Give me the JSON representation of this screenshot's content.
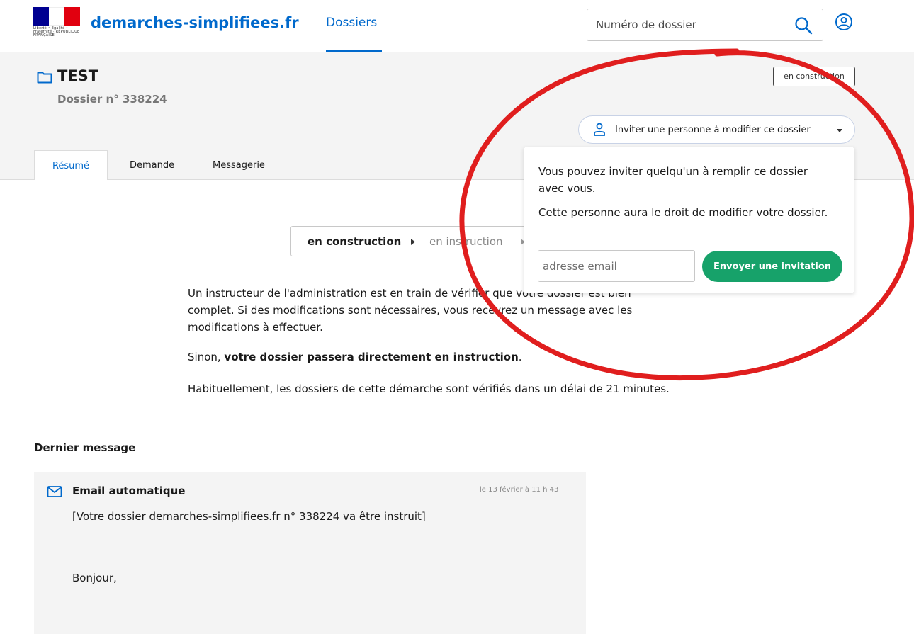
{
  "header": {
    "logo_caption": "Liberté • Égalité • Fraternité · RÉPUBLIQUE FRANÇAISE",
    "site_name": "demarches-simplifiees.fr",
    "nav_dossiers": "Dossiers",
    "search_placeholder": "Numéro de dossier"
  },
  "dossier": {
    "title": "TEST",
    "number": "Dossier n° 338224",
    "status_tag": "en construction",
    "invite_button_label": "Inviter une personne à modifier ce dossier"
  },
  "tabs": [
    {
      "label": "Résumé",
      "active": true
    },
    {
      "label": "Demande",
      "active": false
    },
    {
      "label": "Messagerie",
      "active": false
    }
  ],
  "popover": {
    "text_1": "Vous pouvez inviter quelqu'un à remplir ce dossier avec vous.",
    "text_2": "Cette personne aura le droit de modifier votre dossier.",
    "email_placeholder": "adresse email",
    "send_label": "Envoyer une invitation"
  },
  "progress": {
    "step_1": "en construction",
    "step_2": "en instruction"
  },
  "description": {
    "p1": "Un instructeur de l'administration est en train de vérifier que votre dossier est bien complet. Si des modifications sont nécessaires, vous recevrez un message avec les modifications à effectuer.",
    "p2_prefix": "Sinon, ",
    "p2_bold": "votre dossier passera directement en instruction",
    "p2_suffix": ".",
    "p3": "Habituellement, les dossiers de cette démarche sont vérifiés dans un délai de 21 minutes."
  },
  "last_message": {
    "title": "Dernier message",
    "author": "Email automatique",
    "date": "le 13 février à 11 h 43",
    "subject": "[Votre dossier demarches-simplifiees.fr n° 338224 va être instruit]",
    "greeting": "Bonjour,"
  },
  "colors": {
    "brand_blue": "#0069cc",
    "success_green": "#17a26a",
    "annotation_red": "#e01e1e"
  }
}
